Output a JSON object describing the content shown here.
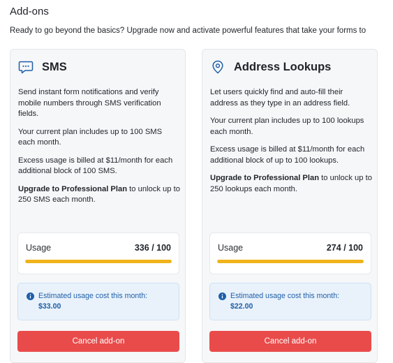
{
  "header": {
    "title": "Add-ons",
    "subtitle": "Ready to go beyond the basics? Upgrade now and activate powerful features that take your forms to"
  },
  "colors": {
    "accent": "#1f5fa8",
    "usage_fill": "#f0b31b",
    "danger": "#e94b4b"
  },
  "addons": [
    {
      "icon": "chat-bubble-icon",
      "title": "SMS",
      "description": "Send instant form notifications and verify mobile numbers through SMS verification fields.",
      "plan_info": "Your current plan includes up to 100 SMS each month.",
      "excess_info": "Excess usage is billed at $11/month for each additional block of 100 SMS.",
      "upgrade_link": "Upgrade to Professional Plan",
      "upgrade_text": " to unlock up to 250 SMS each month.",
      "usage_label": "Usage",
      "usage_value": "336 / 100",
      "usage_fraction": 1.0,
      "cost_label": "Estimated usage cost this month:",
      "cost_amount": "$33.00",
      "cancel_label": "Cancel add-on"
    },
    {
      "icon": "location-pin-icon",
      "title": "Address Lookups",
      "description": "Let users quickly find and auto-fill their address as they type in an address field.",
      "plan_info": "Your current plan includes up to 100 lookups each month.",
      "excess_info": "Excess usage is billed at $11/month for each additional block of up to 100 lookups.",
      "upgrade_link": "Upgrade to Professional Plan",
      "upgrade_text": " to unlock up to 250 lookups each month.",
      "usage_label": "Usage",
      "usage_value": "274 / 100",
      "usage_fraction": 1.0,
      "cost_label": "Estimated usage cost this month:",
      "cost_amount": "$22.00",
      "cancel_label": "Cancel add-on"
    }
  ]
}
